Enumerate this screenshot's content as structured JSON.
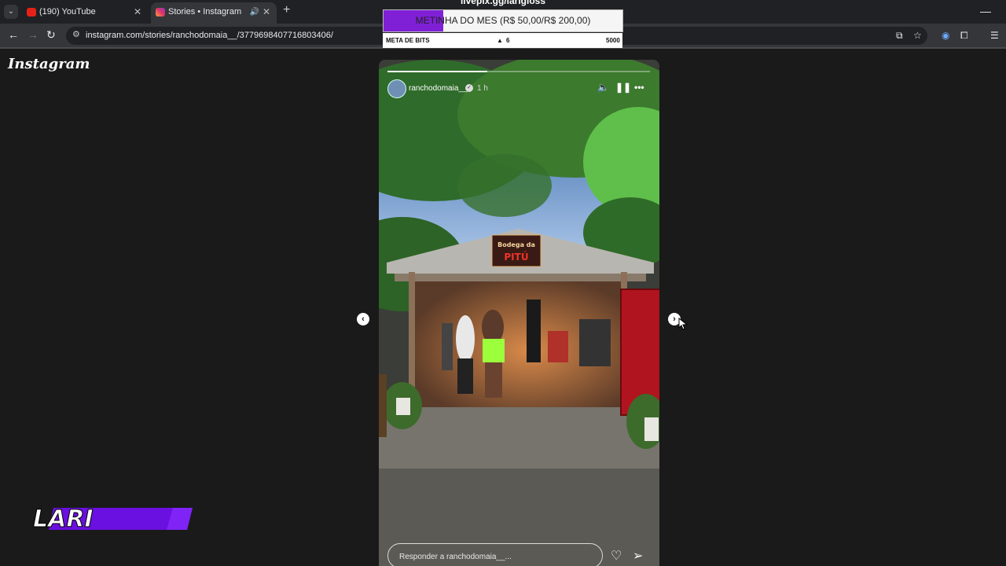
{
  "browser": {
    "tabs": [
      {
        "title": "(190) YouTube",
        "active": false,
        "icon": "youtube-icon"
      },
      {
        "title": "Stories • Instagram",
        "active": true,
        "icon": "instagram-icon"
      }
    ],
    "url": "instagram.com/stories/ranchodomaia__/3779698407716803406/"
  },
  "overlay": {
    "goal_title": "livepix.gg/larigloss",
    "goal_text": "METINHA DO MES (R$ 50,00/R$ 200,00)",
    "goal_progress": 0.25,
    "bits_label": "META DE BITS",
    "bits_current": "6",
    "bits_target": "5000",
    "streamer_logo": "LARI"
  },
  "instagram": {
    "logo": "Instagram",
    "story": {
      "username": "ranchodomaia__",
      "time": "1 h",
      "sign_text": "Bodega da PITÚ",
      "reply_placeholder": "Responder a ranchodomaia__...",
      "progress": 0.38
    }
  },
  "colors": {
    "overlay_purple": "#7f1fd6",
    "browser_dark": "#202124",
    "page_bg": "#1a1a1a"
  }
}
